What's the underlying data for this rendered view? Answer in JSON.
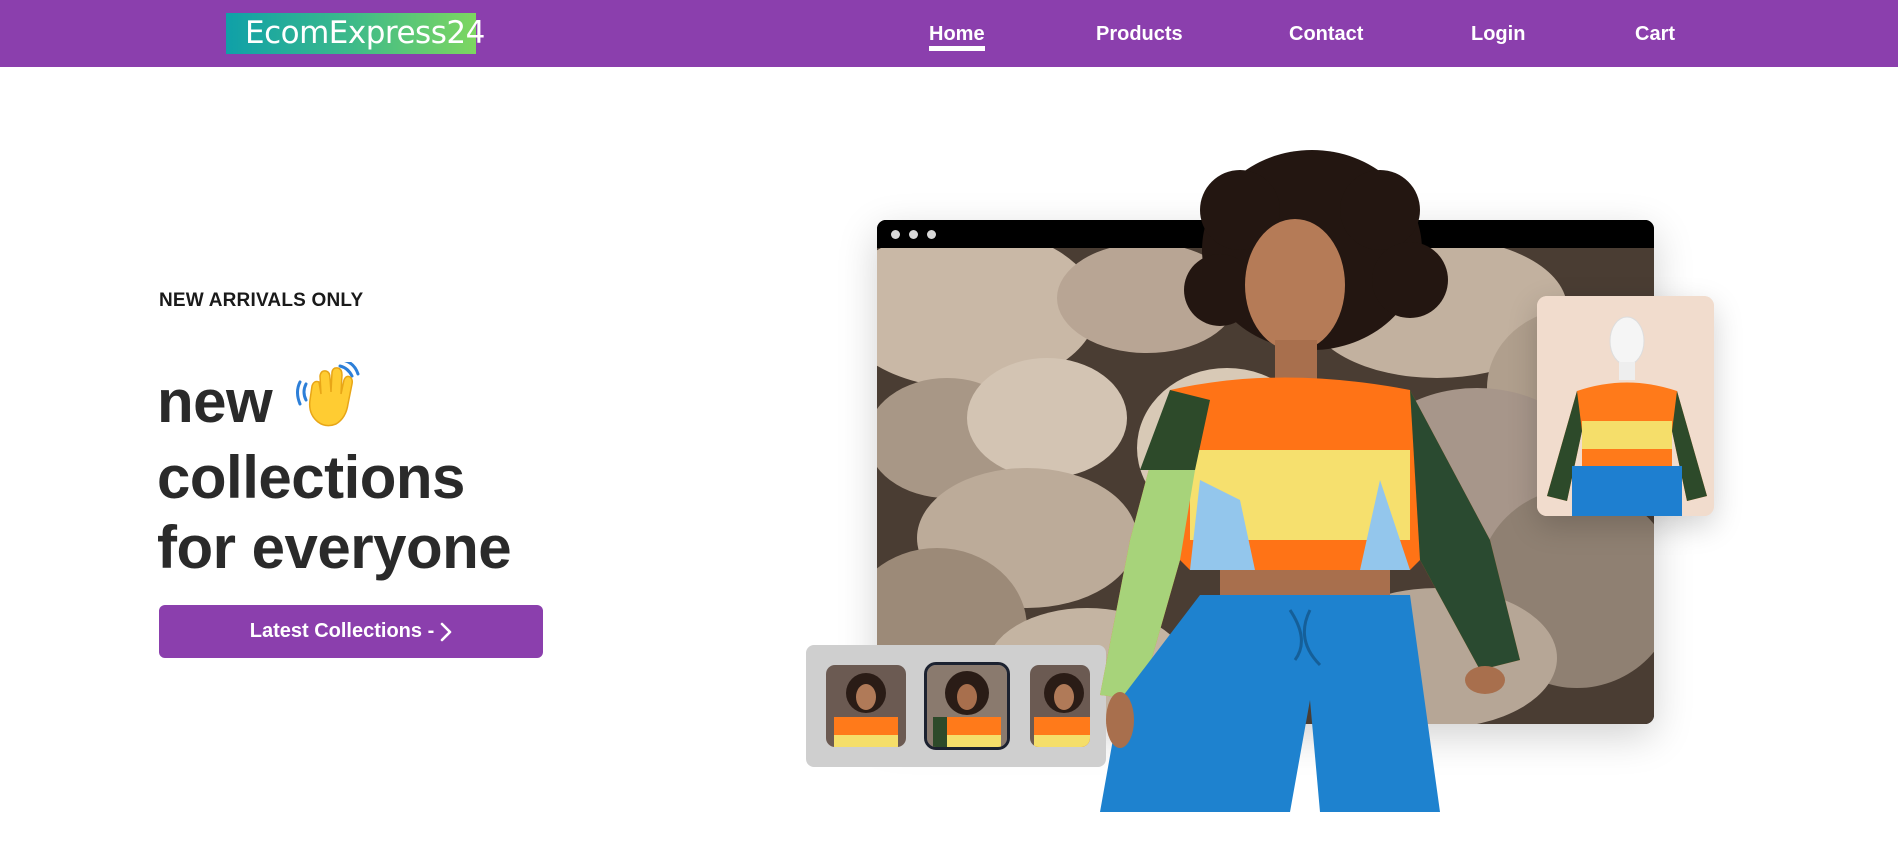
{
  "brand": {
    "logo_text": "EcomExpress24"
  },
  "nav": {
    "items": [
      {
        "label": "Home",
        "active": true
      },
      {
        "label": "Products",
        "active": false
      },
      {
        "label": "Contact",
        "active": false
      },
      {
        "label": "Login",
        "active": false
      },
      {
        "label": "Cart",
        "active": false
      }
    ]
  },
  "hero": {
    "eyebrow": "NEW ARRIVALS ONLY",
    "headline_line1": "new",
    "headline_line2": "collections",
    "headline_line3": "for everyone",
    "wave_icon": "waving-hand-icon",
    "cta_label": "Latest Collections -",
    "cta_icon": "chevron-right-icon"
  },
  "colors": {
    "navbar": "#8b3fad",
    "cta": "#8b3fad",
    "logo_gradient_start": "#0fa0a8",
    "logo_gradient_end": "#7dd660",
    "headline": "#2a2a2a"
  }
}
